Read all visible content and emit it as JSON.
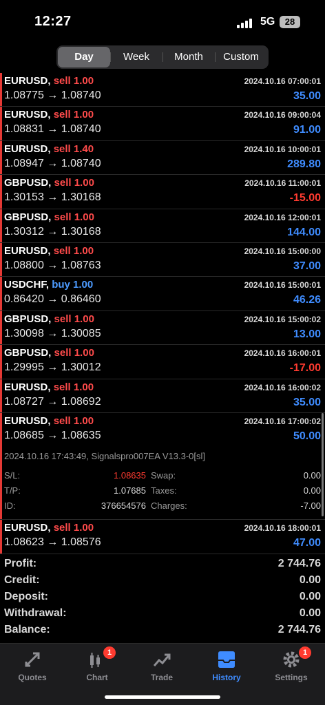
{
  "status_bar": {
    "time": "12:27",
    "network": "5G",
    "battery": "28"
  },
  "period_tabs": [
    "Day",
    "Week",
    "Month",
    "Custom"
  ],
  "active_period": "Day",
  "deals": [
    {
      "symbol": "EURUSD,",
      "side": "sell",
      "volume": "1.00",
      "open": "1.08775",
      "close": "1.08740",
      "datetime": "2024.10.16 07:00:01",
      "profit": "35.00"
    },
    {
      "symbol": "EURUSD,",
      "side": "sell",
      "volume": "1.00",
      "open": "1.08831",
      "close": "1.08740",
      "datetime": "2024.10.16 09:00:04",
      "profit": "91.00"
    },
    {
      "symbol": "EURUSD,",
      "side": "sell",
      "volume": "1.40",
      "open": "1.08947",
      "close": "1.08740",
      "datetime": "2024.10.16 10:00:01",
      "profit": "289.80"
    },
    {
      "symbol": "GBPUSD,",
      "side": "sell",
      "volume": "1.00",
      "open": "1.30153",
      "close": "1.30168",
      "datetime": "2024.10.16 11:00:01",
      "profit": "-15.00"
    },
    {
      "symbol": "GBPUSD,",
      "side": "sell",
      "volume": "1.00",
      "open": "1.30312",
      "close": "1.30168",
      "datetime": "2024.10.16 12:00:01",
      "profit": "144.00"
    },
    {
      "symbol": "EURUSD,",
      "side": "sell",
      "volume": "1.00",
      "open": "1.08800",
      "close": "1.08763",
      "datetime": "2024.10.16 15:00:00",
      "profit": "37.00"
    },
    {
      "symbol": "USDCHF,",
      "side": "buy",
      "volume": "1.00",
      "open": "0.86420",
      "close": "0.86460",
      "datetime": "2024.10.16 15:00:01",
      "profit": "46.26"
    },
    {
      "symbol": "GBPUSD,",
      "side": "sell",
      "volume": "1.00",
      "open": "1.30098",
      "close": "1.30085",
      "datetime": "2024.10.16 15:00:02",
      "profit": "13.00"
    },
    {
      "symbol": "GBPUSD,",
      "side": "sell",
      "volume": "1.00",
      "open": "1.29995",
      "close": "1.30012",
      "datetime": "2024.10.16 16:00:01",
      "profit": "-17.00"
    },
    {
      "symbol": "EURUSD,",
      "side": "sell",
      "volume": "1.00",
      "open": "1.08727",
      "close": "1.08692",
      "datetime": "2024.10.16 16:00:02",
      "profit": "35.00"
    },
    {
      "symbol": "EURUSD,",
      "side": "sell",
      "volume": "1.00",
      "open": "1.08685",
      "close": "1.08635",
      "datetime": "2024.10.16 17:00:02",
      "profit": "50.00"
    },
    {
      "symbol": "EURUSD,",
      "side": "sell",
      "volume": "1.00",
      "open": "1.08623",
      "close": "1.08576",
      "datetime": "2024.10.16 18:00:01",
      "profit": "47.00"
    }
  ],
  "expanded_deal": {
    "close_info": "2024.10.16 17:43:49, Signalspro007EA V13.3-0[sl]",
    "sl_label": "S/L:",
    "sl_value": "1.08635",
    "tp_label": "T/P:",
    "tp_value": "1.07685",
    "id_label": "ID:",
    "id_value": "376654576",
    "swap_label": "Swap:",
    "swap_value": "0.00",
    "taxes_label": "Taxes:",
    "taxes_value": "0.00",
    "charges_label": "Charges:",
    "charges_value": "-7.00"
  },
  "summary": [
    {
      "label": "Profit:",
      "value": "2 744.76"
    },
    {
      "label": "Credit:",
      "value": "0.00"
    },
    {
      "label": "Deposit:",
      "value": "0.00"
    },
    {
      "label": "Withdrawal:",
      "value": "0.00"
    },
    {
      "label": "Balance:",
      "value": "2 744.76"
    }
  ],
  "tab_bar": [
    {
      "label": "Quotes",
      "icon": "quotes-icon",
      "badge": ""
    },
    {
      "label": "Chart",
      "icon": "chart-icon",
      "badge": "1"
    },
    {
      "label": "Trade",
      "icon": "trade-icon",
      "badge": ""
    },
    {
      "label": "History",
      "icon": "history-icon",
      "badge": ""
    },
    {
      "label": "Settings",
      "icon": "settings-icon",
      "badge": "1"
    }
  ],
  "active_tab": "History",
  "colors": {
    "sell": "#ff4b4b",
    "buy": "#4d9bff",
    "profit_positive": "#3f8cff",
    "profit_negative": "#ff3b30",
    "active_tab": "#3f8cff"
  }
}
